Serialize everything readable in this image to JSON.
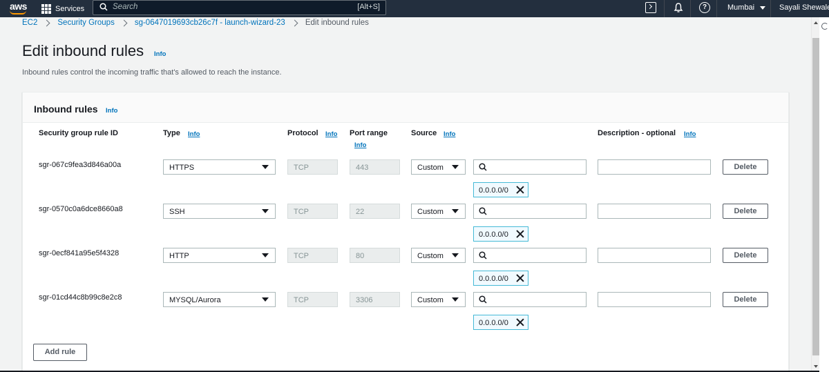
{
  "nav": {
    "logo": "aws",
    "services": "Services",
    "search_placeholder": "Search",
    "search_shortcut": "[Alt+S]",
    "region": "Mumbai",
    "user": "Sayali Shewale",
    "help_glyph": "?"
  },
  "breadcrumb": {
    "items": [
      "EC2",
      "Security Groups",
      "sg-0647019693cb26c7f - launch-wizard-23"
    ],
    "current": "Edit inbound rules"
  },
  "page": {
    "title": "Edit inbound rules",
    "info": "Info",
    "description": "Inbound rules control the incoming traffic that's allowed to reach the instance."
  },
  "panel": {
    "title": "Inbound rules",
    "info": "Info",
    "headers": {
      "rule_id": "Security group rule ID",
      "type": "Type",
      "protocol": "Protocol",
      "port_range": "Port range",
      "source": "Source",
      "description": "Description - optional"
    },
    "header_info": "Info",
    "delete_label": "Delete",
    "add_rule_label": "Add rule",
    "rules": [
      {
        "id": "sgr-067c9fea3d846a00a",
        "type": "HTTPS",
        "protocol": "TCP",
        "port": "443",
        "source": "Custom",
        "cidr": "0.0.0.0/0"
      },
      {
        "id": "sgr-0570c0a6dce8660a8",
        "type": "SSH",
        "protocol": "TCP",
        "port": "22",
        "source": "Custom",
        "cidr": "0.0.0.0/0"
      },
      {
        "id": "sgr-0ecf841a95e5f4328",
        "type": "HTTP",
        "protocol": "TCP",
        "port": "80",
        "source": "Custom",
        "cidr": "0.0.0.0/0"
      },
      {
        "id": "sgr-01cd44c8b99c8e2c8",
        "type": "MYSQL/Aurora",
        "protocol": "TCP",
        "port": "3306",
        "source": "Custom",
        "cidr": "0.0.0.0/0"
      }
    ]
  },
  "icons": {
    "logo": "aws-logo-icon",
    "services": "grid-icon",
    "search": "search-icon",
    "cloudshell": "terminal-icon",
    "notifications": "bell-icon",
    "help": "help-icon",
    "dropdown": "chevron-down-icon",
    "remove": "close-icon"
  },
  "colors": {
    "nav_bg": "#232f3e",
    "link": "#0073bb",
    "token_border": "#44b9d6",
    "token_bg": "#f1faff",
    "accent": "#ff9900"
  }
}
